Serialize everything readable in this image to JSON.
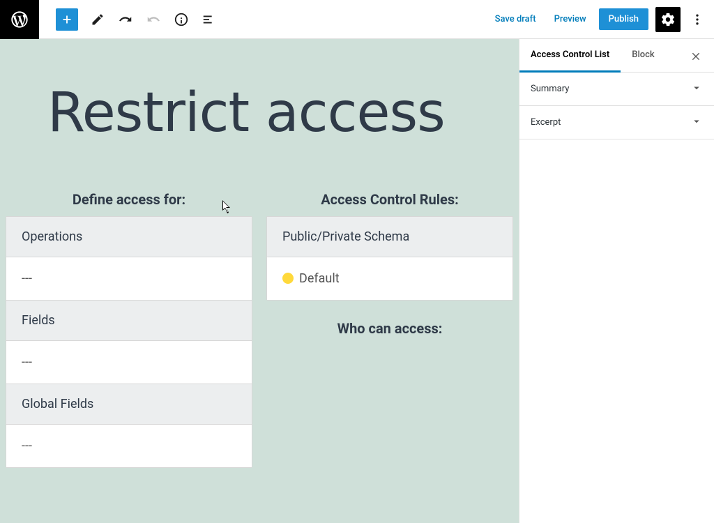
{
  "topbar": {
    "save_draft": "Save draft",
    "preview": "Preview",
    "publish": "Publish"
  },
  "sidebar": {
    "tabs": {
      "acl": "Access Control List",
      "block": "Block"
    },
    "panels": {
      "summary": "Summary",
      "excerpt": "Excerpt"
    }
  },
  "editor": {
    "title": "Restrict access",
    "left": {
      "heading": "Define access for:",
      "sections": [
        {
          "header": "Operations",
          "value": "---"
        },
        {
          "header": "Fields",
          "value": "---"
        },
        {
          "header": "Global Fields",
          "value": "---"
        }
      ]
    },
    "right": {
      "heading": "Access Control Rules:",
      "rule_header": "Public/Private Schema",
      "rule_value": "Default",
      "who_heading": "Who can access:"
    }
  }
}
